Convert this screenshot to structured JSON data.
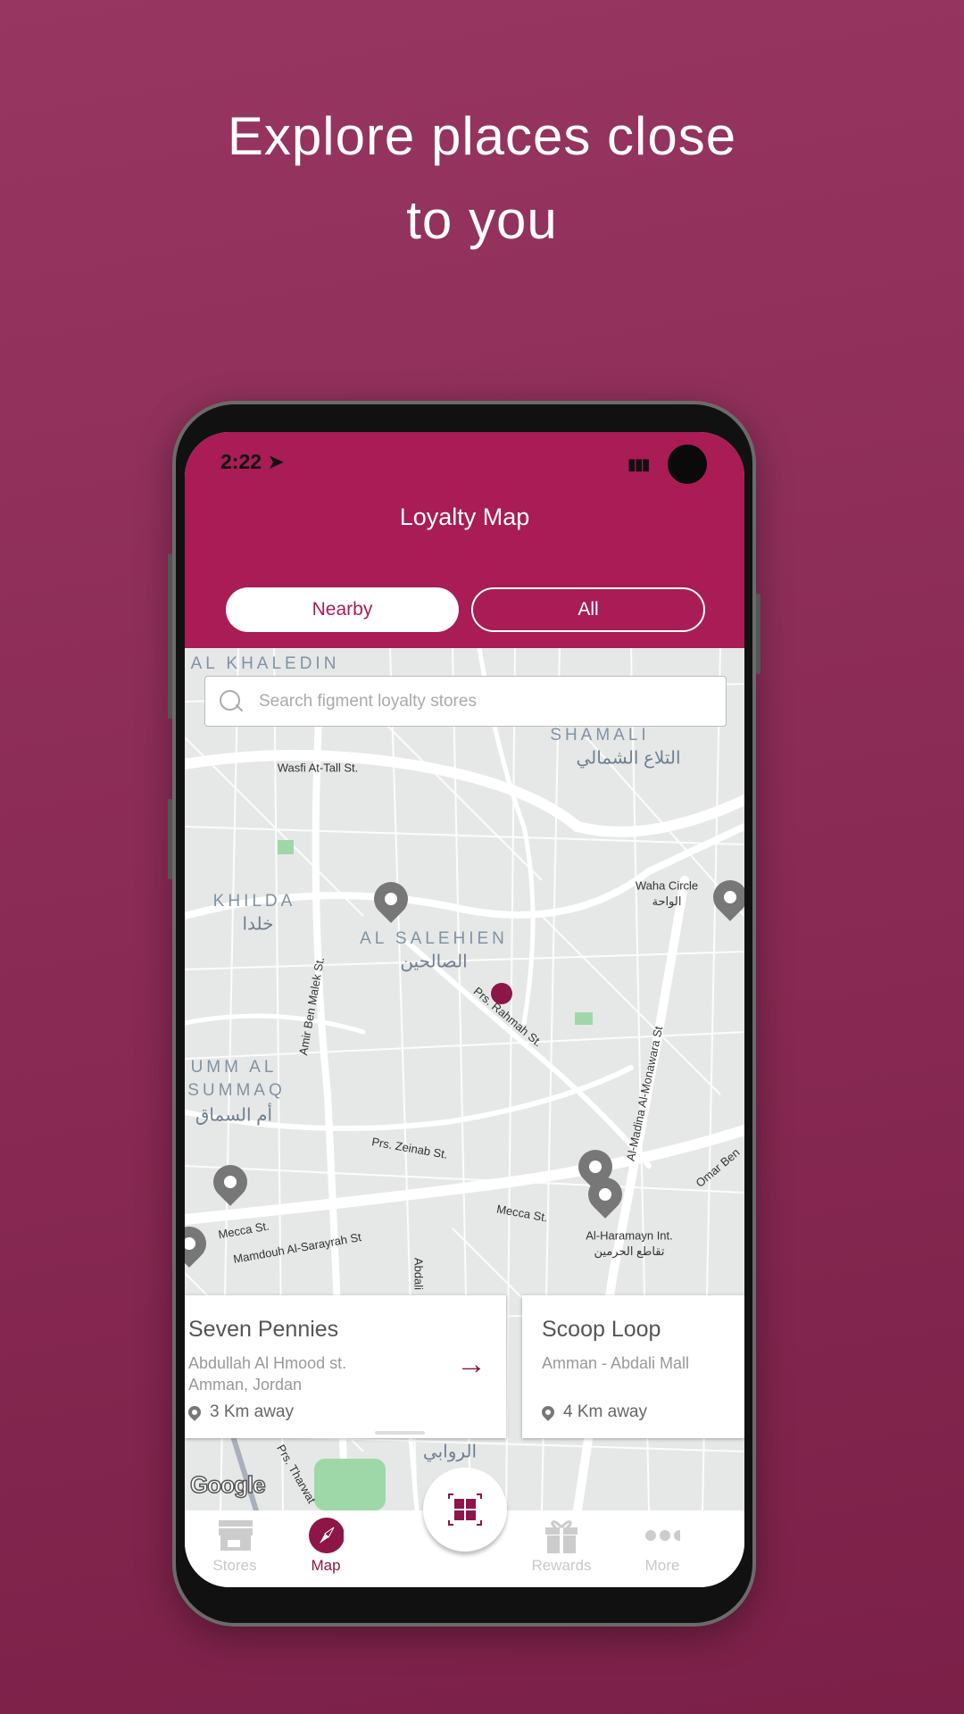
{
  "headline": {
    "line1": "Explore places close",
    "line2": "to you"
  },
  "status": {
    "time": "2:22",
    "icons": [
      "location-arrow-icon",
      "signal-icon",
      "wifi-icon",
      "battery-icon"
    ]
  },
  "header": {
    "title": "Loyalty Map"
  },
  "tabs": [
    {
      "label": "Nearby",
      "active": true
    },
    {
      "label": "All",
      "active": false
    }
  ],
  "search": {
    "placeholder": "Search figment loyalty stores",
    "value": ""
  },
  "map": {
    "labels": [
      "AL KHALEDIN",
      "SHAMALI",
      "التلاع الشمالي",
      "Wasfi At-Tall St.",
      "KHILDA",
      "خلدا",
      "AL SALEHIEN",
      "الصالحين",
      "Prs. Rahmah St.",
      "Amir Ben Malek St.",
      "Waha Circle",
      "الواحة",
      "UMM AL",
      "SUMMAQ",
      "أم السماق",
      "Al-Madina Al-Monawara St",
      "Prs. Zeinab St.",
      "Mecca St.",
      "Al-Haramayn Int.",
      "تقاطع الحرمين",
      "Mamdouh Al-Sarayrah St",
      "Omar Ben",
      "Abdali",
      "Prs. Tharwat",
      "الروابي",
      "Mecca St."
    ],
    "attribution": "Google"
  },
  "stores": [
    {
      "name": "Seven Pennies",
      "address_line1": "Abdullah Al Hmood st.",
      "address_line2": "Amman, Jordan",
      "distance": "3 Km away"
    },
    {
      "name": "Scoop Loop",
      "address_line1": "Amman - Abdali Mall",
      "address_line2": "",
      "distance": "4 Km away"
    }
  ],
  "nav": {
    "items": [
      {
        "label": "Stores",
        "icon": "store-icon",
        "active": false
      },
      {
        "label": "Map",
        "icon": "compass-icon",
        "active": true
      },
      {
        "label": "Rewards",
        "icon": "gift-icon",
        "active": false
      },
      {
        "label": "More",
        "icon": "more-dots-icon",
        "active": false
      }
    ],
    "fab_icon": "qr-scan-icon"
  },
  "colors": {
    "brand": "#a91c55",
    "accent": "#8e1547",
    "background": "#8a2b55"
  }
}
